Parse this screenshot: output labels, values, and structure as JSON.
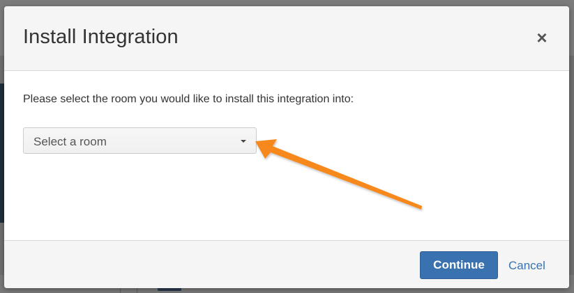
{
  "dialog": {
    "title": "Install Integration",
    "close_label": "×",
    "prompt": "Please select the room you would like to install this integration into:",
    "room_select": {
      "selected_label": "Select a room"
    },
    "continue_label": "Continue",
    "cancel_label": "Cancel"
  },
  "icons": {
    "close": "close-icon",
    "select_caret": "caret-down-icon",
    "annotation": "orange-arrow-annotation"
  },
  "colors": {
    "primary": "#3a72b0",
    "annotation_arrow": "#f7891f",
    "overlay": "#6f6f6f"
  }
}
